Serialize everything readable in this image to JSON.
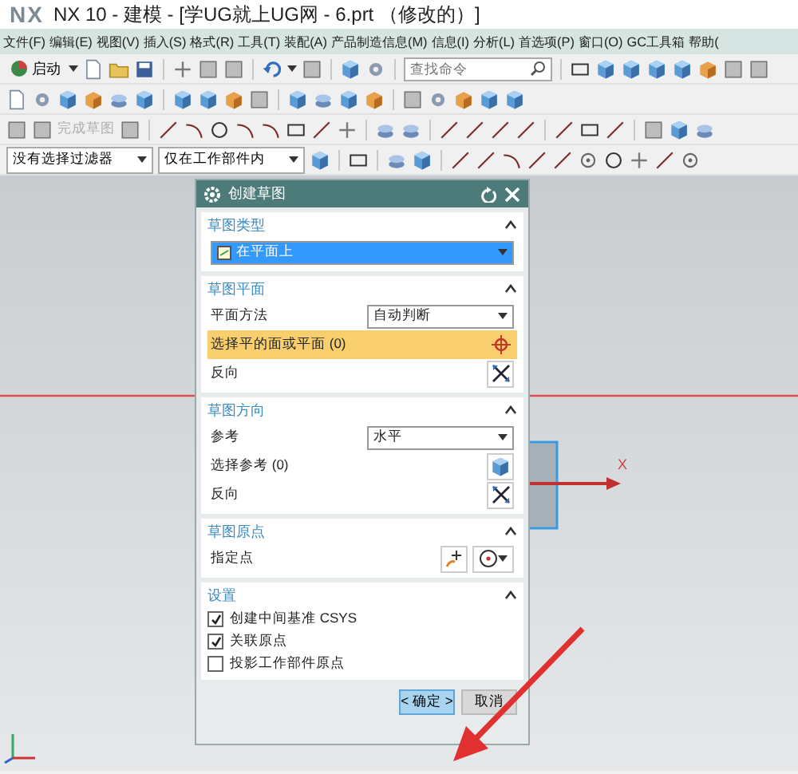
{
  "window": {
    "logo": "NX",
    "title": "NX 10 - 建模 - [学UG就上UG网 - 6.prt （修改的）]"
  },
  "menu": [
    "文件(F)",
    "编辑(E)",
    "视图(V)",
    "插入(S)",
    "格式(R)",
    "工具(T)",
    "装配(A)",
    "产品制造信息(M)",
    "信息(I)",
    "分析(L)",
    "首选项(P)",
    "窗口(O)",
    "GC工具箱",
    "帮助("
  ],
  "toolbar": {
    "start_button": "启动",
    "search": {
      "placeholder": "查找命令"
    },
    "finish_sketch": {
      "label": "完成草图",
      "disabled": true
    }
  },
  "filters": [
    {
      "value": "没有选择过滤器"
    },
    {
      "value": "仅在工作部件内"
    }
  ],
  "viewport": {
    "axis_label": "X"
  },
  "dialog": {
    "title": "创建草图",
    "sections": [
      {
        "title": "草图类型",
        "expanded": true,
        "rows": [
          {
            "kind": "select",
            "value": "在平面上"
          }
        ]
      },
      {
        "title": "草图平面",
        "expanded": true,
        "rows": [
          {
            "kind": "select",
            "label": "平面方法",
            "value": "自动判断"
          },
          {
            "kind": "plane",
            "label": "选择平的面或平面 (0)",
            "active": true
          },
          {
            "kind": "reverse",
            "label": "反向",
            "active": false
          }
        ]
      },
      {
        "title": "草图方向",
        "expanded": true,
        "rows": [
          {
            "kind": "select",
            "label": "参考",
            "value": "水平"
          },
          {
            "kind": "reference",
            "label": "选择参考 (0)",
            "active": false
          },
          {
            "kind": "reverse",
            "label": "反向",
            "active": false
          }
        ]
      },
      {
        "title": "草图原点",
        "expanded": true,
        "rows": [
          {
            "kind": "point",
            "label": "指定点"
          }
        ]
      },
      {
        "title": "设置",
        "expanded": true,
        "rows": [
          {
            "kind": "checkbox",
            "label": "创建中间基准 CSYS",
            "checked": true
          },
          {
            "kind": "checkbox",
            "label": "关联原点",
            "checked": true
          },
          {
            "kind": "checkbox",
            "label": "投影工作部件原点",
            "checked": false
          }
        ]
      }
    ],
    "buttons": [
      {
        "label": "< 确定 >",
        "selected": true
      },
      {
        "label": "取消",
        "selected": false
      }
    ]
  }
}
